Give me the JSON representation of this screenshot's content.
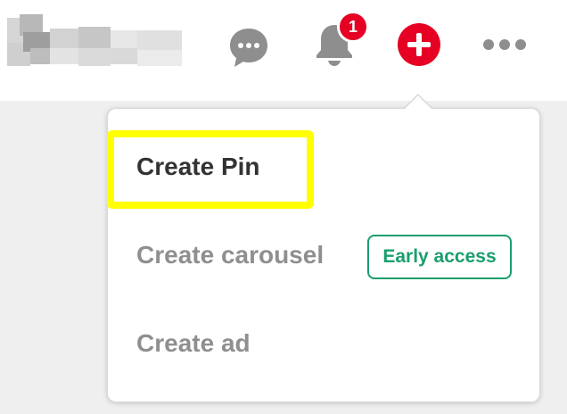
{
  "header": {
    "notification_count": "1",
    "icons": {
      "messages": "chat-bubble-icon",
      "notifications": "bell-icon",
      "create": "plus-circle-icon",
      "more": "ellipsis-icon"
    },
    "colors": {
      "accent": "#e60023",
      "icon_gray": "#8e8e8e"
    }
  },
  "dropdown": {
    "items": [
      {
        "label": "Create Pin",
        "highlighted": true,
        "color": "#333333"
      },
      {
        "label": "Create carousel",
        "badge": "Early access",
        "color": "#8f8f8f"
      },
      {
        "label": "Create ad",
        "color": "#8f8f8f"
      }
    ],
    "highlight_color": "#ffff00",
    "badge_color": "#1a9e6c"
  }
}
